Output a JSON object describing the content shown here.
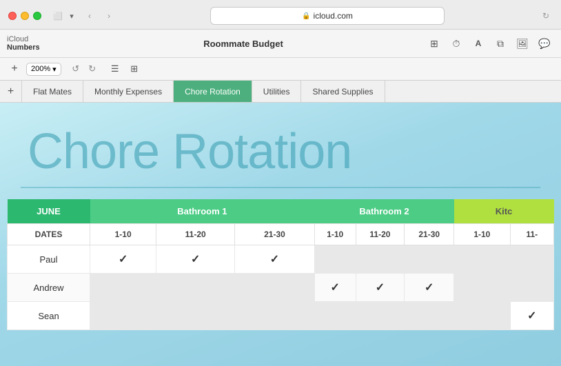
{
  "browser": {
    "url": "icloud.com",
    "traffic_lights": [
      "red",
      "yellow",
      "green"
    ]
  },
  "app": {
    "brand": "iCloud",
    "app_name": "Numbers",
    "doc_title": "Roommate Budget"
  },
  "toolbar": {
    "zoom_label": "200%",
    "zoom_chevron": "▾"
  },
  "tabs": [
    {
      "id": "flat-mates",
      "label": "Flat Mates",
      "active": false
    },
    {
      "id": "monthly-expenses",
      "label": "Monthly Expenses",
      "active": false
    },
    {
      "id": "chore-rotation",
      "label": "Chore Rotation",
      "active": true
    },
    {
      "id": "utilities",
      "label": "Utilities",
      "active": false
    },
    {
      "id": "shared-supplies",
      "label": "Shared Supplies",
      "active": false
    }
  ],
  "sheet": {
    "title": "Chore Rotation",
    "table": {
      "headers": {
        "month": "JUNE",
        "col1": "Bathroom 1",
        "col2": "Bathroom 2",
        "col3": "Kitc"
      },
      "subheaders": {
        "dates": "DATES",
        "ranges": [
          "1-10",
          "11-20",
          "21-30",
          "1-10",
          "11-20",
          "21-30",
          "1-10",
          "11-"
        ]
      },
      "rows": [
        {
          "name": "Paul",
          "checks": [
            true,
            true,
            true,
            false,
            false,
            false,
            false,
            false
          ]
        },
        {
          "name": "Andrew",
          "checks": [
            false,
            false,
            false,
            true,
            true,
            true,
            false,
            false
          ]
        },
        {
          "name": "Sean",
          "checks": [
            false,
            false,
            false,
            false,
            false,
            false,
            false,
            true
          ]
        }
      ]
    }
  }
}
